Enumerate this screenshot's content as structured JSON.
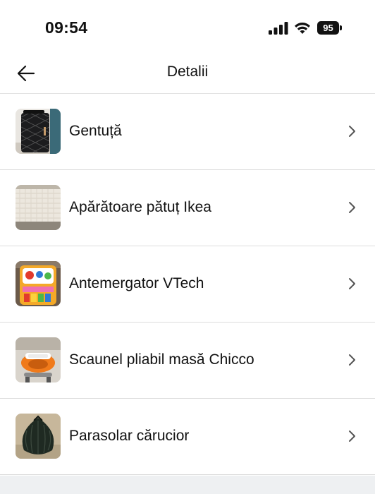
{
  "status_bar": {
    "time": "09:54",
    "battery": "95",
    "icons": [
      "signal-icon",
      "wifi-icon",
      "battery-icon"
    ]
  },
  "header": {
    "title": "Detalii",
    "back_icon": "arrow-left-icon"
  },
  "items": [
    {
      "label": "Gentuță",
      "thumbnail": "black quilted bag"
    },
    {
      "label": "Apărătoare pătuț Ikea",
      "thumbnail": "quilted bed bumper"
    },
    {
      "label": "Antemergator VTech",
      "thumbnail": "colorful baby walker toy"
    },
    {
      "label": "Scaunel pliabil masă Chicco",
      "thumbnail": "orange folding chair"
    },
    {
      "label": "Parasolar cărucior",
      "thumbnail": "dark green stroller sunshade"
    }
  ],
  "colors": {
    "background": "#ffffff",
    "divider": "#dcdcdc",
    "footer": "#eef0f2",
    "text": "#111111",
    "chevron": "#555555"
  }
}
